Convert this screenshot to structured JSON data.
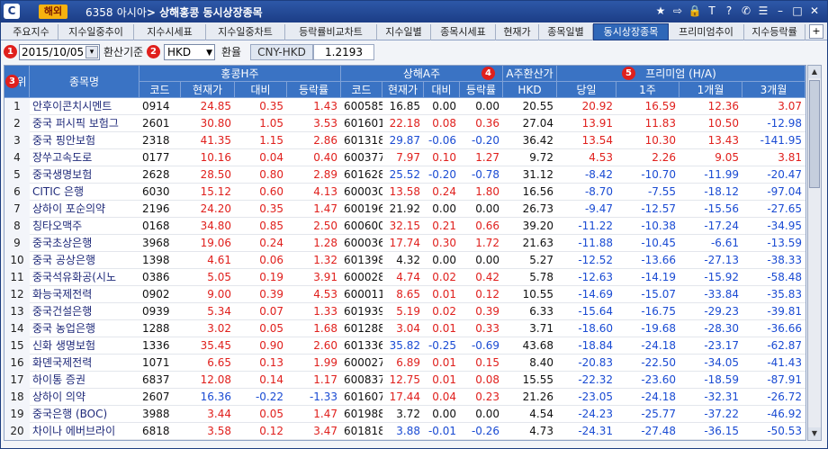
{
  "titlebar": {
    "logo": "C",
    "badge": "해외",
    "code": "6358",
    "menu": "아시아",
    "title": "상해홍콩 동시상장종목"
  },
  "tabs": [
    {
      "label": "주요지수"
    },
    {
      "label": "지수일중추이"
    },
    {
      "label": "지수시세표"
    },
    {
      "label": "지수일중차트"
    },
    {
      "label": "등락률비교차트"
    },
    {
      "label": "지수일별"
    },
    {
      "label": "종목시세표"
    },
    {
      "label": "현재가"
    },
    {
      "label": "종목일별"
    },
    {
      "label": "동시상장종목",
      "active": true
    },
    {
      "label": "프리미엄추이"
    },
    {
      "label": "지수등락률"
    }
  ],
  "tab_add": "+",
  "controls": {
    "date": "2015/10/05",
    "exchange_label": "환산기준",
    "currency": "HKD",
    "rate_label": "환율",
    "pair": "CNY-HKD",
    "rate": "1.2193"
  },
  "badges": [
    "1",
    "2",
    "3",
    "4",
    "5"
  ],
  "headers": {
    "rank": "순위",
    "name": "종목명",
    "hk_group": "홍콩H주",
    "sh_group": "상해A주",
    "conv_group": "A주환산가",
    "prem_group": "프리미엄 (H/A)",
    "code": "코드",
    "price": "현재가",
    "change": "대비",
    "rate": "등락률",
    "hkd": "HKD",
    "today": "당일",
    "w1": "1주",
    "m1": "1개월",
    "m3": "3개월"
  },
  "rows": [
    {
      "rank": "1",
      "name": "안후이콘치시멘트",
      "hcode": "0914",
      "hprice": "24.85",
      "hchg": "0.35",
      "hrate": "1.43",
      "hc": "red",
      "scode": "600585",
      "sprice": "16.85",
      "schg": "0.00",
      "srate": "0.00",
      "sc": "blk",
      "conv": "20.55",
      "p0": "20.92",
      "p1": "16.59",
      "p2": "12.36",
      "p3": "3.07",
      "pc": [
        "red",
        "red",
        "red",
        "red"
      ]
    },
    {
      "rank": "2",
      "name": "중국 퍼시픽 보험그",
      "hcode": "2601",
      "hprice": "30.80",
      "hchg": "1.05",
      "hrate": "3.53",
      "hc": "red",
      "scode": "601601",
      "sprice": "22.18",
      "schg": "0.08",
      "srate": "0.36",
      "sc": "red",
      "conv": "27.04",
      "p0": "13.91",
      "p1": "11.83",
      "p2": "10.50",
      "p3": "-12.98",
      "pc": [
        "red",
        "red",
        "red",
        "blue"
      ]
    },
    {
      "rank": "3",
      "name": "중국 핑안보험",
      "hcode": "2318",
      "hprice": "41.35",
      "hchg": "1.15",
      "hrate": "2.86",
      "hc": "red",
      "scode": "601318",
      "sprice": "29.87",
      "schg": "-0.06",
      "srate": "-0.20",
      "sc": "blue",
      "conv": "36.42",
      "p0": "13.54",
      "p1": "10.30",
      "p2": "13.43",
      "p3": "-141.95",
      "pc": [
        "red",
        "red",
        "red",
        "blue"
      ]
    },
    {
      "rank": "4",
      "name": "장쑤고속도로",
      "hcode": "0177",
      "hprice": "10.16",
      "hchg": "0.04",
      "hrate": "0.40",
      "hc": "red",
      "scode": "600377",
      "sprice": "7.97",
      "schg": "0.10",
      "srate": "1.27",
      "sc": "red",
      "conv": "9.72",
      "p0": "4.53",
      "p1": "2.26",
      "p2": "9.05",
      "p3": "3.81",
      "pc": [
        "red",
        "red",
        "red",
        "red"
      ]
    },
    {
      "rank": "5",
      "name": "중국생명보험",
      "hcode": "2628",
      "hprice": "28.50",
      "hchg": "0.80",
      "hrate": "2.89",
      "hc": "red",
      "scode": "601628",
      "sprice": "25.52",
      "schg": "-0.20",
      "srate": "-0.78",
      "sc": "blue",
      "conv": "31.12",
      "p0": "-8.42",
      "p1": "-10.70",
      "p2": "-11.99",
      "p3": "-20.47",
      "pc": [
        "blue",
        "blue",
        "blue",
        "blue"
      ]
    },
    {
      "rank": "6",
      "name": "CITIC 은행",
      "hcode": "6030",
      "hprice": "15.12",
      "hchg": "0.60",
      "hrate": "4.13",
      "hc": "red",
      "scode": "600030",
      "sprice": "13.58",
      "schg": "0.24",
      "srate": "1.80",
      "sc": "red",
      "conv": "16.56",
      "p0": "-8.70",
      "p1": "-7.55",
      "p2": "-18.12",
      "p3": "-97.04",
      "pc": [
        "blue",
        "blue",
        "blue",
        "blue"
      ]
    },
    {
      "rank": "7",
      "name": "상하이 포순의약",
      "hcode": "2196",
      "hprice": "24.20",
      "hchg": "0.35",
      "hrate": "1.47",
      "hc": "red",
      "scode": "600196",
      "sprice": "21.92",
      "schg": "0.00",
      "srate": "0.00",
      "sc": "blk",
      "conv": "26.73",
      "p0": "-9.47",
      "p1": "-12.57",
      "p2": "-15.56",
      "p3": "-27.65",
      "pc": [
        "blue",
        "blue",
        "blue",
        "blue"
      ]
    },
    {
      "rank": "8",
      "name": "칭타오맥주",
      "hcode": "0168",
      "hprice": "34.80",
      "hchg": "0.85",
      "hrate": "2.50",
      "hc": "red",
      "scode": "600600",
      "sprice": "32.15",
      "schg": "0.21",
      "srate": "0.66",
      "sc": "red",
      "conv": "39.20",
      "p0": "-11.22",
      "p1": "-10.38",
      "p2": "-17.24",
      "p3": "-34.95",
      "pc": [
        "blue",
        "blue",
        "blue",
        "blue"
      ]
    },
    {
      "rank": "9",
      "name": "중국초상은행",
      "hcode": "3968",
      "hprice": "19.06",
      "hchg": "0.24",
      "hrate": "1.28",
      "hc": "red",
      "scode": "600036",
      "sprice": "17.74",
      "schg": "0.30",
      "srate": "1.72",
      "sc": "red",
      "conv": "21.63",
      "p0": "-11.88",
      "p1": "-10.45",
      "p2": "-6.61",
      "p3": "-13.59",
      "pc": [
        "blue",
        "blue",
        "blue",
        "blue"
      ]
    },
    {
      "rank": "10",
      "name": "중국 공상은행",
      "hcode": "1398",
      "hprice": "4.61",
      "hchg": "0.06",
      "hrate": "1.32",
      "hc": "red",
      "scode": "601398",
      "sprice": "4.32",
      "schg": "0.00",
      "srate": "0.00",
      "sc": "blk",
      "conv": "5.27",
      "p0": "-12.52",
      "p1": "-13.66",
      "p2": "-27.13",
      "p3": "-38.33",
      "pc": [
        "blue",
        "blue",
        "blue",
        "blue"
      ]
    },
    {
      "rank": "11",
      "name": "중국석유화공(시노",
      "hcode": "0386",
      "hprice": "5.05",
      "hchg": "0.19",
      "hrate": "3.91",
      "hc": "red",
      "scode": "600028",
      "sprice": "4.74",
      "schg": "0.02",
      "srate": "0.42",
      "sc": "red",
      "conv": "5.78",
      "p0": "-12.63",
      "p1": "-14.19",
      "p2": "-15.92",
      "p3": "-58.48",
      "pc": [
        "blue",
        "blue",
        "blue",
        "blue"
      ]
    },
    {
      "rank": "12",
      "name": "화능국제전력",
      "hcode": "0902",
      "hprice": "9.00",
      "hchg": "0.39",
      "hrate": "4.53",
      "hc": "red",
      "scode": "600011",
      "sprice": "8.65",
      "schg": "0.01",
      "srate": "0.12",
      "sc": "red",
      "conv": "10.55",
      "p0": "-14.69",
      "p1": "-15.07",
      "p2": "-33.84",
      "p3": "-35.83",
      "pc": [
        "blue",
        "blue",
        "blue",
        "blue"
      ]
    },
    {
      "rank": "13",
      "name": "중국건설은행",
      "hcode": "0939",
      "hprice": "5.34",
      "hchg": "0.07",
      "hrate": "1.33",
      "hc": "red",
      "scode": "601939",
      "sprice": "5.19",
      "schg": "0.02",
      "srate": "0.39",
      "sc": "red",
      "conv": "6.33",
      "p0": "-15.64",
      "p1": "-16.75",
      "p2": "-29.23",
      "p3": "-39.81",
      "pc": [
        "blue",
        "blue",
        "blue",
        "blue"
      ]
    },
    {
      "rank": "14",
      "name": "중국 농업은행",
      "hcode": "1288",
      "hprice": "3.02",
      "hchg": "0.05",
      "hrate": "1.68",
      "hc": "red",
      "scode": "601288",
      "sprice": "3.04",
      "schg": "0.01",
      "srate": "0.33",
      "sc": "red",
      "conv": "3.71",
      "p0": "-18.60",
      "p1": "-19.68",
      "p2": "-28.30",
      "p3": "-36.66",
      "pc": [
        "blue",
        "blue",
        "blue",
        "blue"
      ]
    },
    {
      "rank": "15",
      "name": "신화 생명보험",
      "hcode": "1336",
      "hprice": "35.45",
      "hchg": "0.90",
      "hrate": "2.60",
      "hc": "red",
      "scode": "601336",
      "sprice": "35.82",
      "schg": "-0.25",
      "srate": "-0.69",
      "sc": "blue",
      "conv": "43.68",
      "p0": "-18.84",
      "p1": "-24.18",
      "p2": "-23.17",
      "p3": "-62.87",
      "pc": [
        "blue",
        "blue",
        "blue",
        "blue"
      ]
    },
    {
      "rank": "16",
      "name": "화뎬국제전력",
      "hcode": "1071",
      "hprice": "6.65",
      "hchg": "0.13",
      "hrate": "1.99",
      "hc": "red",
      "scode": "600027",
      "sprice": "6.89",
      "schg": "0.01",
      "srate": "0.15",
      "sc": "red",
      "conv": "8.40",
      "p0": "-20.83",
      "p1": "-22.50",
      "p2": "-34.05",
      "p3": "-41.43",
      "pc": [
        "blue",
        "blue",
        "blue",
        "blue"
      ]
    },
    {
      "rank": "17",
      "name": "하이통 증권",
      "hcode": "6837",
      "hprice": "12.08",
      "hchg": "0.14",
      "hrate": "1.17",
      "hc": "red",
      "scode": "600837",
      "sprice": "12.75",
      "schg": "0.01",
      "srate": "0.08",
      "sc": "red",
      "conv": "15.55",
      "p0": "-22.32",
      "p1": "-23.60",
      "p2": "-18.59",
      "p3": "-87.91",
      "pc": [
        "blue",
        "blue",
        "blue",
        "blue"
      ]
    },
    {
      "rank": "18",
      "name": "상하이 의약",
      "hcode": "2607",
      "hprice": "16.36",
      "hchg": "-0.22",
      "hrate": "-1.33",
      "hc": "blue",
      "scode": "601607",
      "sprice": "17.44",
      "schg": "0.04",
      "srate": "0.23",
      "sc": "red",
      "conv": "21.26",
      "p0": "-23.05",
      "p1": "-24.18",
      "p2": "-32.31",
      "p3": "-26.72",
      "pc": [
        "blue",
        "blue",
        "blue",
        "blue"
      ]
    },
    {
      "rank": "19",
      "name": "중국은행 (BOC)",
      "hcode": "3988",
      "hprice": "3.44",
      "hchg": "0.05",
      "hrate": "1.47",
      "hc": "red",
      "scode": "601988",
      "sprice": "3.72",
      "schg": "0.00",
      "srate": "0.00",
      "sc": "blk",
      "conv": "4.54",
      "p0": "-24.23",
      "p1": "-25.77",
      "p2": "-37.22",
      "p3": "-46.92",
      "pc": [
        "blue",
        "blue",
        "blue",
        "blue"
      ]
    },
    {
      "rank": "20",
      "name": "차이나 에버브라이",
      "hcode": "6818",
      "hprice": "3.58",
      "hchg": "0.12",
      "hrate": "3.47",
      "hc": "red",
      "scode": "601818",
      "sprice": "3.88",
      "schg": "-0.01",
      "srate": "-0.26",
      "sc": "blue",
      "conv": "4.73",
      "p0": "-24.31",
      "p1": "-27.48",
      "p2": "-36.15",
      "p3": "-50.53",
      "pc": [
        "blue",
        "blue",
        "blue",
        "blue"
      ]
    }
  ]
}
